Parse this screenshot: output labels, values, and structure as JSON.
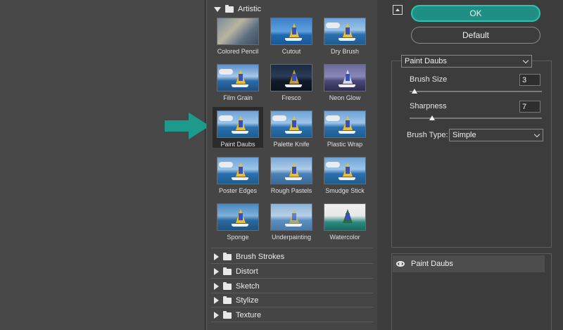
{
  "gallery": {
    "artistic_label": "Artistic",
    "filters": [
      {
        "label": "Colored Pencil"
      },
      {
        "label": "Cutout"
      },
      {
        "label": "Dry Brush"
      },
      {
        "label": "Film Grain"
      },
      {
        "label": "Fresco"
      },
      {
        "label": "Neon Glow"
      },
      {
        "label": "Paint Daubs"
      },
      {
        "label": "Palette Knife"
      },
      {
        "label": "Plastic Wrap"
      },
      {
        "label": "Poster Edges"
      },
      {
        "label": "Rough Pastels"
      },
      {
        "label": "Smudge Stick"
      },
      {
        "label": "Sponge"
      },
      {
        "label": "Underpainting"
      },
      {
        "label": "Watercolor"
      }
    ],
    "selected": "Paint Daubs",
    "categories": [
      "Brush Strokes",
      "Distort",
      "Sketch",
      "Stylize",
      "Texture"
    ]
  },
  "buttons": {
    "ok": "OK",
    "default": "Default"
  },
  "settings": {
    "filter_select": "Paint Daubs",
    "brush_size_label": "Brush Size",
    "brush_size_value": "3",
    "sharpness_label": "Sharpness",
    "sharpness_value": "7",
    "brush_type_label": "Brush Type:",
    "brush_type_value": "Simple"
  },
  "layers": {
    "items": [
      {
        "label": "Paint Daubs"
      }
    ]
  },
  "colors": {
    "accent": "#1f8f84",
    "arrow": "#1e9a8c"
  },
  "icons": [
    "collapse-icon",
    "folder-icon",
    "triangle-down-icon",
    "triangle-right-icon",
    "eye-icon",
    "arrow-right-icon",
    "chevron-down-icon"
  ]
}
